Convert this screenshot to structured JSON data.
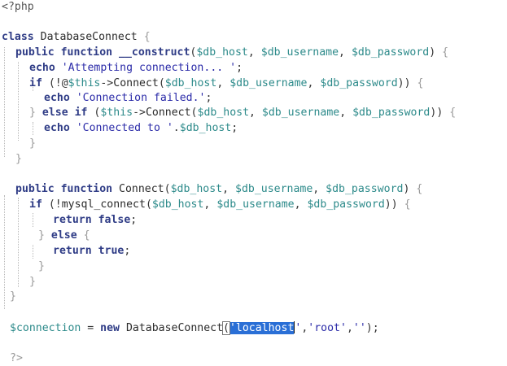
{
  "editor": {
    "lines": [
      {
        "tokens": [
          {
            "t": "<?php",
            "c": "ptag"
          }
        ]
      },
      {
        "tokens": []
      },
      {
        "tokens": [
          {
            "t": "class ",
            "c": "kw"
          },
          {
            "t": "DatabaseConnect ",
            "c": "fn"
          },
          {
            "t": "{",
            "c": "grey"
          }
        ]
      },
      {
        "tokens": [
          {
            "t": "public ",
            "c": "kw"
          },
          {
            "t": "function ",
            "c": "kw"
          },
          {
            "t": "__construct",
            "c": "kw"
          },
          {
            "t": "(",
            "c": "pun"
          },
          {
            "t": "$db_host",
            "c": "var"
          },
          {
            "t": ", ",
            "c": "pun"
          },
          {
            "t": "$db_username",
            "c": "var"
          },
          {
            "t": ", ",
            "c": "pun"
          },
          {
            "t": "$db_password",
            "c": "var"
          },
          {
            "t": ") ",
            "c": "pun"
          },
          {
            "t": "{",
            "c": "grey"
          }
        ]
      },
      {
        "tokens": [
          {
            "t": "echo ",
            "c": "kw"
          },
          {
            "t": "'Attempting connection... '",
            "c": "str"
          },
          {
            "t": ";",
            "c": "pun"
          }
        ]
      },
      {
        "tokens": [
          {
            "t": "if ",
            "c": "kw"
          },
          {
            "t": "(!@",
            "c": "pun"
          },
          {
            "t": "$this",
            "c": "var"
          },
          {
            "t": "->",
            "c": "pun"
          },
          {
            "t": "Connect",
            "c": "fn"
          },
          {
            "t": "(",
            "c": "pun"
          },
          {
            "t": "$db_host",
            "c": "var"
          },
          {
            "t": ", ",
            "c": "pun"
          },
          {
            "t": "$db_username",
            "c": "var"
          },
          {
            "t": ", ",
            "c": "pun"
          },
          {
            "t": "$db_password",
            "c": "var"
          },
          {
            "t": ")) ",
            "c": "pun"
          },
          {
            "t": "{",
            "c": "grey"
          }
        ]
      },
      {
        "tokens": [
          {
            "t": "echo ",
            "c": "kw"
          },
          {
            "t": "'Connection failed.'",
            "c": "str"
          },
          {
            "t": ";",
            "c": "pun"
          }
        ]
      },
      {
        "tokens": [
          {
            "t": "} ",
            "c": "grey"
          },
          {
            "t": "else ",
            "c": "kw"
          },
          {
            "t": "if ",
            "c": "kw"
          },
          {
            "t": "(",
            "c": "pun"
          },
          {
            "t": "$this",
            "c": "var"
          },
          {
            "t": "->",
            "c": "pun"
          },
          {
            "t": "Connect",
            "c": "fn"
          },
          {
            "t": "(",
            "c": "pun"
          },
          {
            "t": "$db_host",
            "c": "var"
          },
          {
            "t": ", ",
            "c": "pun"
          },
          {
            "t": "$db_username",
            "c": "var"
          },
          {
            "t": ", ",
            "c": "pun"
          },
          {
            "t": "$db_password",
            "c": "var"
          },
          {
            "t": ")) ",
            "c": "pun"
          },
          {
            "t": "{",
            "c": "grey"
          }
        ]
      },
      {
        "tokens": [
          {
            "t": "echo ",
            "c": "kw"
          },
          {
            "t": "'Connected to '",
            "c": "str"
          },
          {
            "t": ".",
            "c": "pun"
          },
          {
            "t": "$db_host",
            "c": "var"
          },
          {
            "t": ";",
            "c": "pun"
          }
        ]
      },
      {
        "tokens": [
          {
            "t": "}",
            "c": "grey"
          }
        ]
      },
      {
        "tokens": [
          {
            "t": "}",
            "c": "grey"
          }
        ]
      },
      {
        "tokens": []
      },
      {
        "tokens": [
          {
            "t": "public ",
            "c": "kw"
          },
          {
            "t": "function ",
            "c": "kw"
          },
          {
            "t": "Connect",
            "c": "fn"
          },
          {
            "t": "(",
            "c": "pun"
          },
          {
            "t": "$db_host",
            "c": "var"
          },
          {
            "t": ", ",
            "c": "pun"
          },
          {
            "t": "$db_username",
            "c": "var"
          },
          {
            "t": ", ",
            "c": "pun"
          },
          {
            "t": "$db_password",
            "c": "var"
          },
          {
            "t": ") ",
            "c": "pun"
          },
          {
            "t": "{",
            "c": "grey"
          }
        ]
      },
      {
        "tokens": [
          {
            "t": "if ",
            "c": "kw"
          },
          {
            "t": "(!",
            "c": "pun"
          },
          {
            "t": "mysql_connect",
            "c": "fn"
          },
          {
            "t": "(",
            "c": "pun"
          },
          {
            "t": "$db_host",
            "c": "var"
          },
          {
            "t": ", ",
            "c": "pun"
          },
          {
            "t": "$db_username",
            "c": "var"
          },
          {
            "t": ", ",
            "c": "pun"
          },
          {
            "t": "$db_password",
            "c": "var"
          },
          {
            "t": ")) ",
            "c": "pun"
          },
          {
            "t": "{",
            "c": "grey"
          }
        ]
      },
      {
        "tokens": [
          {
            "t": "return ",
            "c": "kw"
          },
          {
            "t": "false",
            "c": "kw"
          },
          {
            "t": ";",
            "c": "pun"
          }
        ]
      },
      {
        "tokens": [
          {
            "t": "} ",
            "c": "grey"
          },
          {
            "t": "else ",
            "c": "kw"
          },
          {
            "t": "{",
            "c": "grey"
          }
        ]
      },
      {
        "tokens": [
          {
            "t": "return ",
            "c": "kw"
          },
          {
            "t": "true",
            "c": "kw"
          },
          {
            "t": ";",
            "c": "pun"
          }
        ]
      },
      {
        "tokens": [
          {
            "t": "}",
            "c": "grey"
          }
        ]
      },
      {
        "tokens": [
          {
            "t": "}",
            "c": "grey"
          }
        ]
      },
      {
        "tokens": [
          {
            "t": "}",
            "c": "grey"
          }
        ]
      },
      {
        "tokens": []
      },
      {
        "tokens": [
          {
            "t": "$connection",
            "c": "var"
          },
          {
            "t": " = ",
            "c": "pun"
          },
          {
            "t": "new ",
            "c": "kw"
          },
          {
            "t": "DatabaseConnect",
            "c": "fn"
          },
          {
            "t": "(",
            "c": "pun bracket"
          },
          {
            "t": "'localhost",
            "c": "str sel"
          },
          {
            "t": "",
            "c": "caret"
          },
          {
            "t": "'",
            "c": "str"
          },
          {
            "t": ",",
            "c": "pun"
          },
          {
            "t": "'root'",
            "c": "str"
          },
          {
            "t": ",",
            "c": "pun"
          },
          {
            "t": "''",
            "c": "str"
          },
          {
            "t": ");",
            "c": "pun"
          }
        ]
      },
      {
        "tokens": []
      },
      {
        "tokens": []
      },
      {
        "tokens": [
          {
            "t": "?>",
            "c": "grey"
          }
        ]
      }
    ]
  },
  "colors": {
    "keyword": "#2f3c86",
    "variable": "#2c8a8a",
    "string": "#2a2aa8",
    "selection": "#2a6fd6"
  }
}
